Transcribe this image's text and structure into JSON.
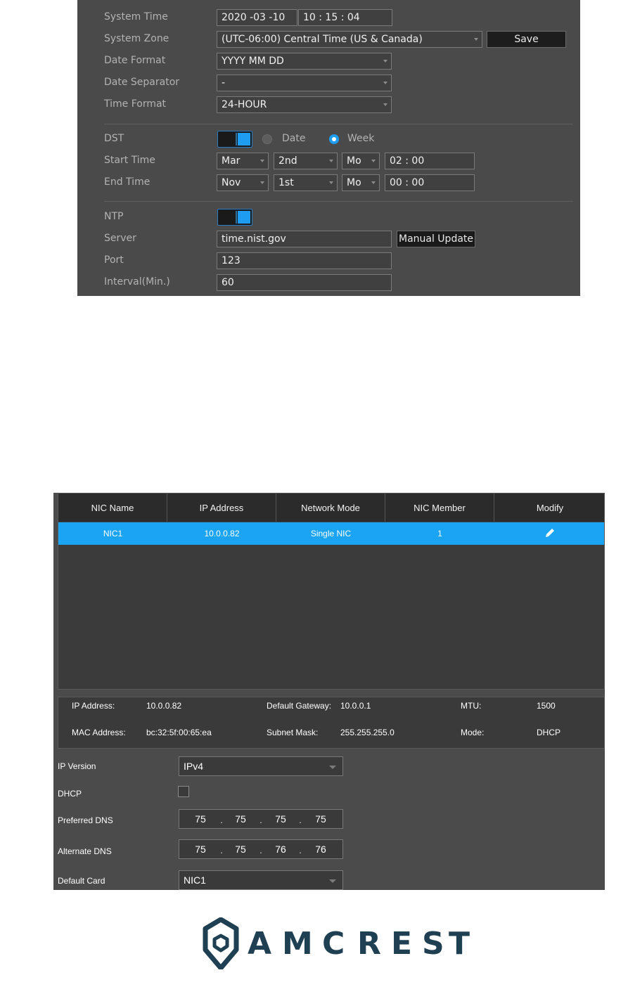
{
  "time": {
    "system_time": {
      "label": "System Time",
      "date": "2020  -03 -10",
      "clock": "10 : 15 : 04"
    },
    "system_zone": {
      "label": "System Zone",
      "value": "(UTC-06:00) Central Time (US & Canada)"
    },
    "save_label": "Save",
    "date_format": {
      "label": "Date Format",
      "value": "YYYY MM DD"
    },
    "date_separator": {
      "label": "Date Separator",
      "value": "-"
    },
    "time_format": {
      "label": "Time Format",
      "value": "24-HOUR"
    },
    "dst": {
      "label": "DST",
      "enabled": true,
      "option_date": "Date",
      "option_week": "Week",
      "selected": "Week"
    },
    "start_time": {
      "label": "Start Time",
      "month": "Mar",
      "week": "2nd",
      "day": "Mo",
      "clock": "02 : 00"
    },
    "end_time": {
      "label": "End Time",
      "month": "Nov",
      "week": "1st",
      "day": "Mo",
      "clock": "00 : 00"
    },
    "ntp": {
      "label": "NTP",
      "enabled": true
    },
    "server": {
      "label": "Server",
      "value": "time.nist.gov"
    },
    "manual_update_label": "Manual Update",
    "port": {
      "label": "Port",
      "value": "123"
    },
    "interval": {
      "label": "Interval(Min.)",
      "value": "60"
    }
  },
  "network": {
    "table": {
      "columns": [
        "NIC Name",
        "IP Address",
        "Network Mode",
        "NIC Member",
        "Modify"
      ],
      "rows": [
        {
          "nic_name": "NIC1",
          "ip_address": "10.0.0.82",
          "network_mode": "Single NIC",
          "nic_member": "1",
          "modify_icon": "pencil-icon"
        }
      ]
    },
    "info": {
      "ip_address_label": "IP Address:",
      "ip_address": "10.0.0.82",
      "gateway_label": "Default Gateway:",
      "gateway": "10.0.0.1",
      "mtu_label": "MTU:",
      "mtu": "1500",
      "mac_label": "MAC Address:",
      "mac": "bc:32:5f:00:65:ea",
      "subnet_label": "Subnet Mask:",
      "subnet": "255.255.255.0",
      "mode_label": "Mode:",
      "mode": "DHCP"
    },
    "ip_version": {
      "label": "IP Version",
      "value": "IPv4"
    },
    "dhcp": {
      "label": "DHCP",
      "checked": false
    },
    "preferred_dns": {
      "label": "Preferred DNS",
      "octets": [
        "75",
        "75",
        "75",
        "75"
      ]
    },
    "alternate_dns": {
      "label": "Alternate DNS",
      "octets": [
        "75",
        "75",
        "76",
        "76"
      ]
    },
    "default_card": {
      "label": "Default Card",
      "value": "NIC1"
    }
  },
  "brand": {
    "letters": [
      "A",
      "M",
      "C",
      "R",
      "E",
      "S",
      "T"
    ],
    "logo_icon": "amcrest-shield-icon",
    "color": "#1f3f52",
    "accent": "#1aa4f3"
  }
}
